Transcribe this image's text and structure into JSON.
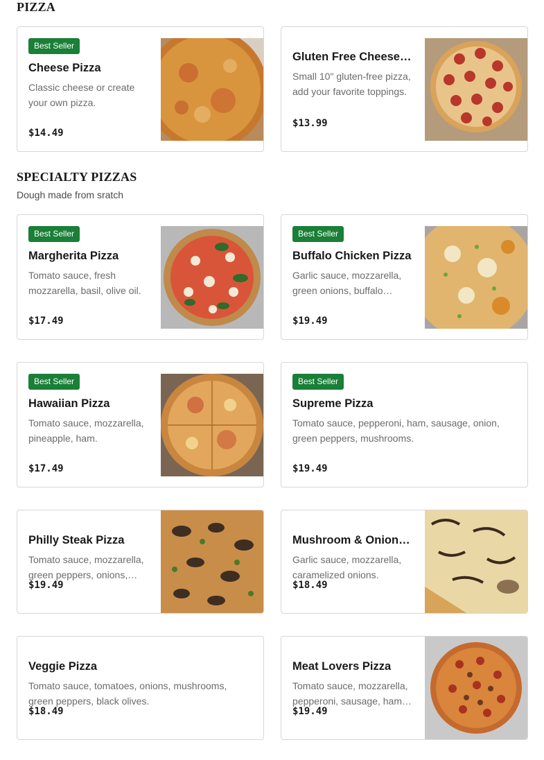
{
  "sections": [
    {
      "title": "PIZZA",
      "subtitle": ""
    },
    {
      "title": "SPECIALTY PIZZAS",
      "subtitle": "Dough made from sratch"
    }
  ],
  "items": [
    {
      "badge": "Best Seller",
      "name": "Cheese Pizza",
      "description": "Classic cheese or create your own pizza.",
      "price": "$14.49",
      "image": "cheese-pizza-photo"
    },
    {
      "badge": "",
      "name": "Gluten Free Cheese Pizza",
      "description": "Small 10\" gluten-free pizza, add your favorite toppings.",
      "price": "$13.99",
      "image": "pepperoni-pizza-photo"
    },
    {
      "badge": "Best Seller",
      "name": "Margherita Pizza",
      "description": "Tomato sauce, fresh mozzarella, basil, olive oil.",
      "price": "$17.49",
      "image": "margherita-pizza-photo"
    },
    {
      "badge": "Best Seller",
      "name": "Buffalo Chicken Pizza",
      "description": "Garlic sauce, mozzarella, green onions, buffalo chicken.",
      "price": "$19.49",
      "image": "buffalo-chicken-pizza-photo"
    },
    {
      "badge": "Best Seller",
      "name": "Hawaiian Pizza",
      "description": "Tomato sauce, mozzarella, pineapple, ham.",
      "price": "$17.49",
      "image": "hawaiian-pizza-photo"
    },
    {
      "badge": "Best Seller",
      "name": "Supreme Pizza",
      "description": "Tomato sauce, pepperoni, ham, sausage, onion, green peppers, mushrooms.",
      "price": "$19.49",
      "image": ""
    },
    {
      "badge": "",
      "name": "Philly Steak Pizza",
      "description": "Tomato sauce, mozzarella, green peppers, onions, steak.",
      "price": "$19.49",
      "image": "philly-steak-pizza-photo"
    },
    {
      "badge": "",
      "name": "Mushroom & Onions Pizza",
      "description": "Garlic sauce, mozzarella, caramelized onions.",
      "price": "$18.49",
      "image": "mushroom-onion-pizza-photo"
    },
    {
      "badge": "",
      "name": "Veggie Pizza",
      "description": "Tomato sauce, tomatoes, onions, mushrooms, green peppers, black olives.",
      "price": "$18.49",
      "image": ""
    },
    {
      "badge": "",
      "name": "Meat Lovers Pizza",
      "description": "Tomato sauce, mozzarella, pepperoni, sausage, ham, bacon.",
      "price": "$19.49",
      "image": "meat-lovers-pizza-photo"
    }
  ]
}
